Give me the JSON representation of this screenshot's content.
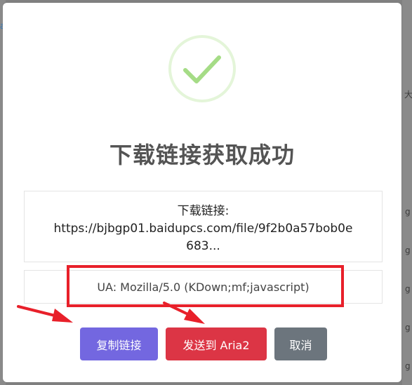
{
  "backdrop": {
    "char_top_left": "a",
    "char_right_1": "大",
    "char_right_2": "g",
    "char_right_3": "g",
    "char_right_4": "g",
    "char_right_5": "g",
    "char_right_6": "g",
    "char_right_7": "g"
  },
  "dialog": {
    "icon": "checkmark-icon",
    "title": "下载链接获取成功",
    "link_label": "下载链接:",
    "link_url_line1": "https://bjbgp01.baidupcs.com/file/9f2b0a57bob0e",
    "link_url_line2": "683...",
    "ua_text": "UA: Mozilla/5.0 (KDown;mf;javascript)"
  },
  "buttons": {
    "copy_label": "复制链接",
    "aria_label": "发送到 Aria2",
    "cancel_label": "取消"
  },
  "colors": {
    "success_green": "#a5dc86",
    "success_ring": "#e4f5d9",
    "copy_button": "#7367e0",
    "aria_button": "#dc3545",
    "cancel_button": "#6c757d",
    "annotation_red": "#e8202a"
  }
}
